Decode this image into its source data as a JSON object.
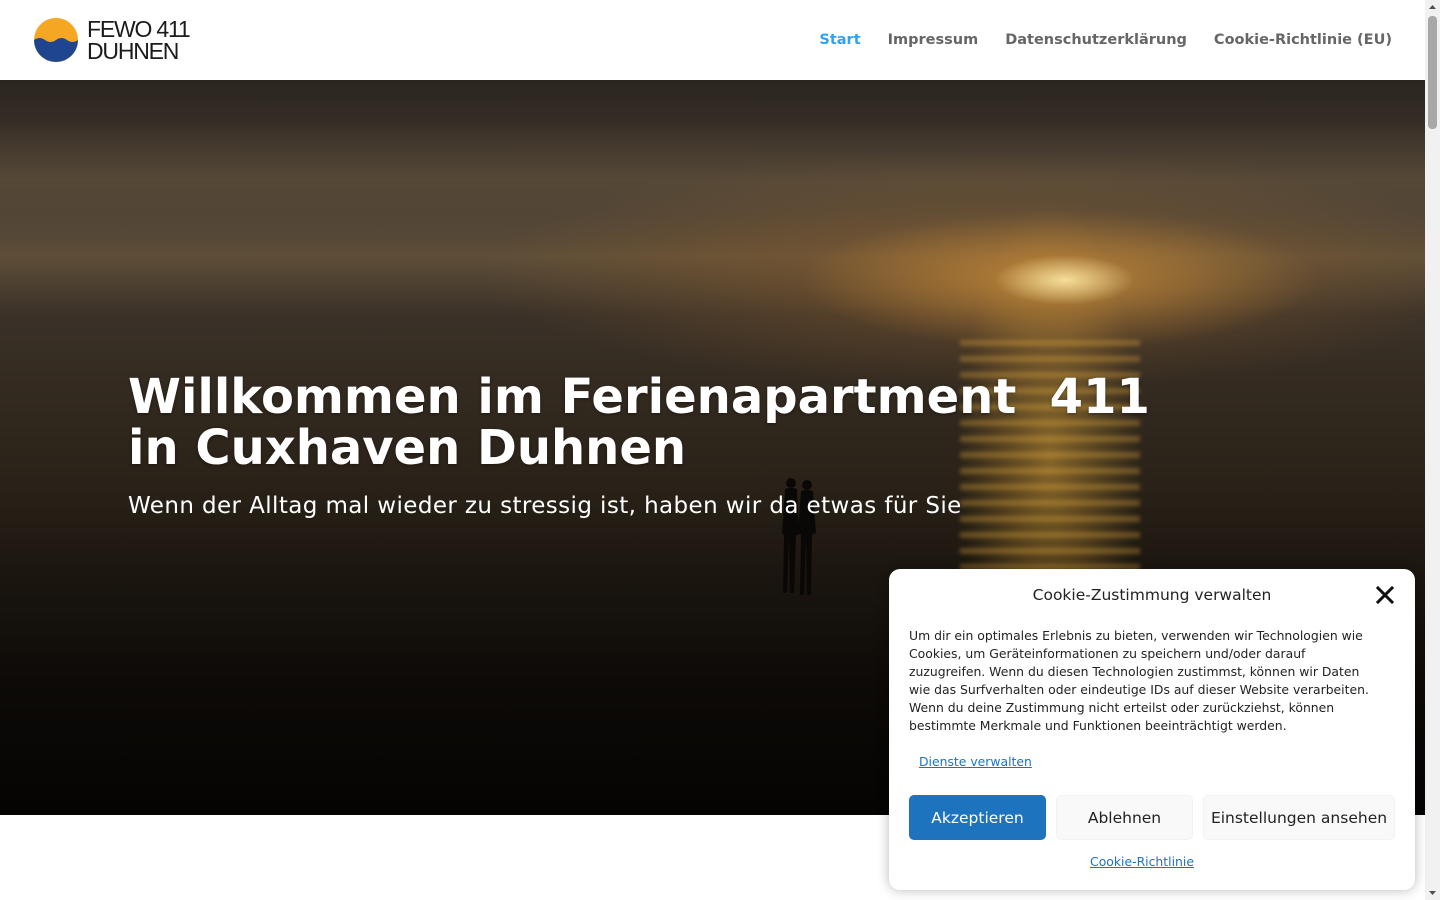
{
  "logo": {
    "line1": "FEWO 411",
    "line2": "DUHNEN"
  },
  "nav": [
    {
      "label": "Start",
      "active": true
    },
    {
      "label": "Impressum",
      "active": false
    },
    {
      "label": "Datenschutzerklärung",
      "active": false
    },
    {
      "label": "Cookie-Richtlinie (EU)",
      "active": false
    }
  ],
  "hero": {
    "title": "Willkommen im Ferienapartment  411\nin Cuxhaven Duhnen",
    "subtitle": "Wenn der Alltag mal wieder zu stressig ist, haben wir da etwas für Sie"
  },
  "cookie": {
    "title": "Cookie-Zustimmung verwalten",
    "body": "Um dir ein optimales Erlebnis zu bieten, verwenden wir Technologien wie Cookies, um Geräteinformationen zu speichern und/oder darauf zuzugreifen. Wenn du diesen Technologien zustimmst, können wir Daten wie das Surfverhalten oder eindeutige IDs auf dieser Website verarbeiten. Wenn du deine Zustimmung nicht erteilst oder zurückziehst, können bestimmte Merkmale und Funktionen beeinträchtigt werden.",
    "manage_link": "Dienste verwalten",
    "accept_label": "Akzeptieren",
    "deny_label": "Ablehnen",
    "settings_label": "Einstellungen ansehen",
    "policy_link": "Cookie-Richtlinie"
  },
  "colors": {
    "accent": "#2ea3f2",
    "nav_text": "#666666",
    "button_primary": "#1e73be",
    "logo_sun": "#f5a623",
    "logo_sea": "#1f4590"
  },
  "scrollbar": {
    "position": 0.0
  }
}
